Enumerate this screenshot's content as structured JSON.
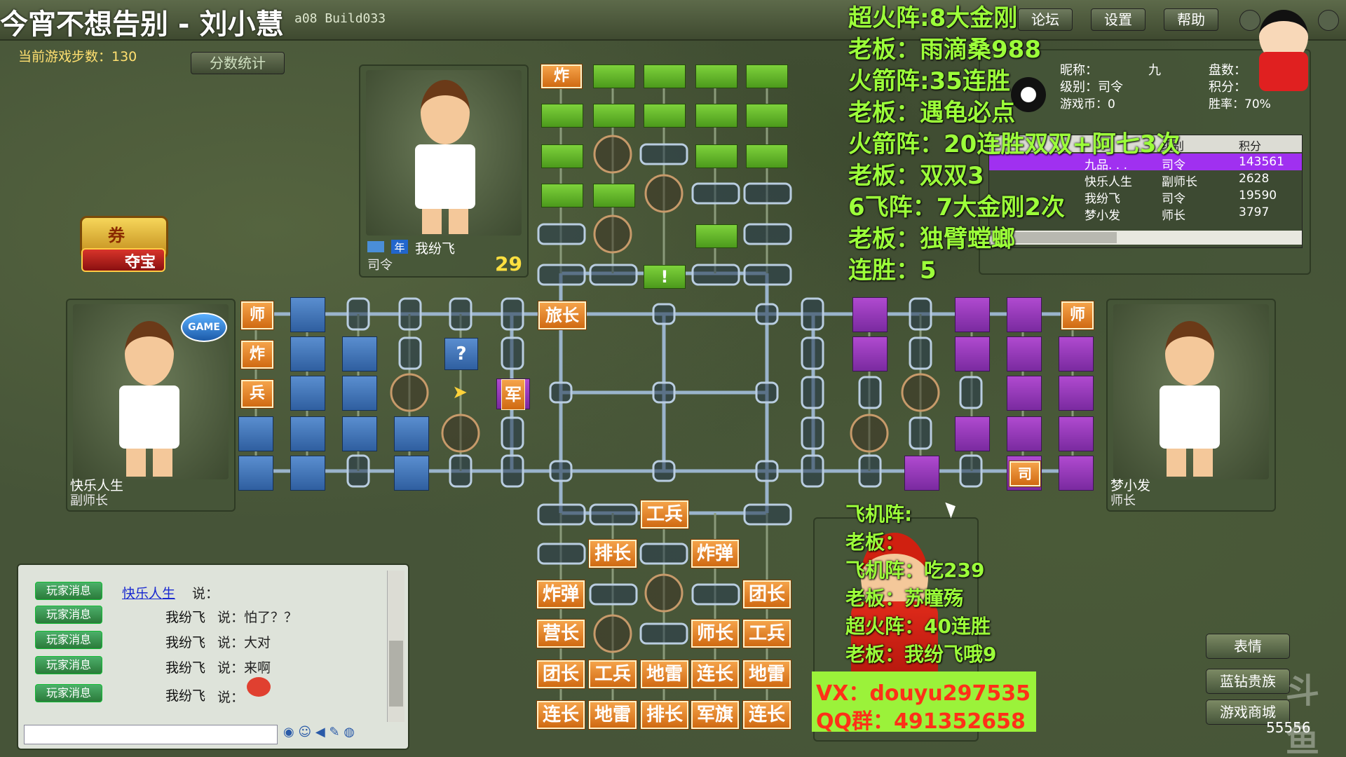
{
  "window": {
    "title_overlay": "今宵不想告别 - 刘小慧",
    "build_text": "a08 Build033",
    "buttons": [
      "论坛",
      "设置",
      "帮助"
    ]
  },
  "game": {
    "steps_label": "当前游戏步数：130",
    "score_stats": "分数统计",
    "treasure_label": "夺宝",
    "coupon_label": "券"
  },
  "players": {
    "top": {
      "name": "我纷飞",
      "rank": "司令",
      "badge": "年",
      "timer": "29"
    },
    "left": {
      "name": "快乐人生",
      "rank": "副师长",
      "game_badge": "GAME"
    },
    "right": {
      "name": "梦小发",
      "rank": "师长"
    }
  },
  "info_panel": {
    "nickname_label": "昵称：",
    "nickname_value": "九",
    "level_label": "级别：司令",
    "coins_label": "游戏币：0",
    "games_label": "盘数：",
    "score_label": "积分：",
    "winrate_label": "胜率：70%",
    "table_headers": [
      "级别",
      "积分"
    ],
    "rows": [
      {
        "name": "九品. . .",
        "level": "司令",
        "score": "143561"
      },
      {
        "name": "快乐人生",
        "level": "副师长",
        "score": "2628"
      },
      {
        "name": "我纷飞",
        "level": "司令",
        "score": "19590"
      },
      {
        "name": "梦小发",
        "level": "师长",
        "score": "3797"
      }
    ]
  },
  "overlay_top": [
    "超火阵:8大金刚",
    "老板：雨滴桑988",
    "火箭阵:35连胜",
    "老板：遇龟必点",
    "火箭阵：20连胜双双+阿七3次",
    "老板：双双3",
    "6飞阵：7大金刚2次",
    "老板：独臂螳螂",
    "连胜：5"
  ],
  "overlay_bottom": [
    "飞机阵:",
    "老板：",
    "飞机阵：吃239",
    "老板：苏瞳殇",
    "超火阵：40连胜",
    "老板：我纷飞哦9"
  ],
  "contact": {
    "vx": "VX：douyu297535",
    "qq": "QQ群：491352658"
  },
  "pieces": {
    "top_bomb": "炸",
    "top_mark": "!",
    "mid_brigade": "旅长",
    "mid_army": "军",
    "mid_question": "?",
    "left_col": [
      "师",
      "炸",
      "兵"
    ],
    "right_col_top": "师",
    "right_col_bottom": "司",
    "bottom_rows": [
      [
        "工兵"
      ],
      [
        "排长",
        "炸弹"
      ],
      [
        "炸弹",
        "团长"
      ],
      [
        "营长",
        "师长",
        "工兵"
      ],
      [
        "团长",
        "工兵",
        "地雷",
        "连长",
        "地雷"
      ],
      [
        "连长",
        "地雷",
        "排长",
        "军旗",
        "连长"
      ]
    ]
  },
  "chat": {
    "tag": "玩家消息",
    "lines": [
      {
        "name": "快乐人生",
        "text": "说："
      },
      {
        "name": "我纷飞",
        "text": "说：怕了？？"
      },
      {
        "name": "我纷飞",
        "text": "说：大对"
      },
      {
        "name": "我纷飞",
        "text": "说：来啊"
      },
      {
        "name": "我纷飞",
        "text": "说："
      }
    ]
  },
  "right_buttons": [
    "表情",
    "蓝钻贵族",
    "游戏商城"
  ],
  "corner_text": "55556",
  "watermark": "斗鱼"
}
